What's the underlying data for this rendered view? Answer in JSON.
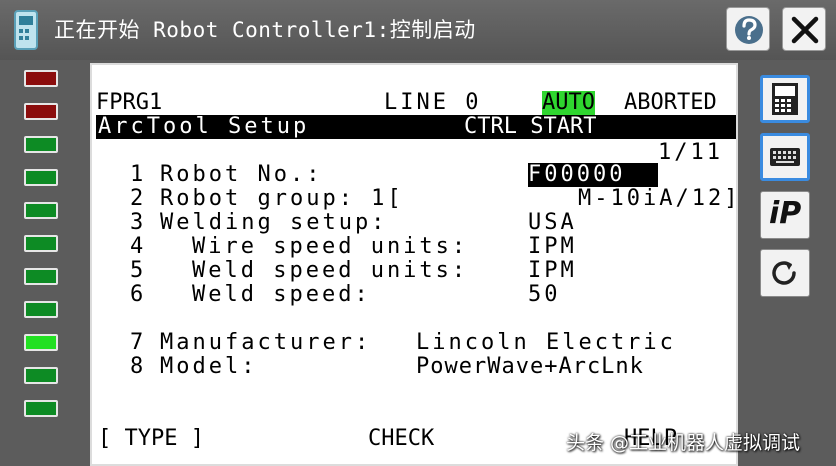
{
  "window": {
    "title": "正在开始 Robot Controller1:控制启动",
    "help_icon": "question-mark-icon",
    "close_icon": "close-x-icon"
  },
  "leds": [
    {
      "state": "red"
    },
    {
      "state": "red"
    },
    {
      "state": "green"
    },
    {
      "state": "green"
    },
    {
      "state": "green"
    },
    {
      "state": "green"
    },
    {
      "state": "green"
    },
    {
      "state": "green"
    },
    {
      "state": "green-lit"
    },
    {
      "state": "green"
    },
    {
      "state": "green"
    }
  ],
  "colors": {
    "led_red": "#8b0d0d",
    "led_green": "#0d8b24",
    "led_green_lit": "#22e022",
    "auto_highlight": "#2fd62f",
    "active_border": "#3a8be0"
  },
  "teach_pendant": {
    "program": "FPRG1",
    "line_label": "LINE 0",
    "mode": "AUTO",
    "status": "ABORTED",
    "screen_title": "ArcTool Setup",
    "screen_action": "CTRL START",
    "page": "1/11",
    "items": [
      {
        "num": "1",
        "label": "Robot No.:",
        "value": "F00000"
      },
      {
        "num": "2",
        "label": "Robot group: 1[",
        "value": "M-10iA/12]"
      },
      {
        "num": "3",
        "label": "Welding setup:",
        "value": "USA"
      },
      {
        "num": "4",
        "label": "Wire speed units:",
        "value": "IPM"
      },
      {
        "num": "5",
        "label": "Weld speed units:",
        "value": "IPM"
      },
      {
        "num": "6",
        "label": "Weld speed:",
        "value": "50"
      },
      {
        "num": "7",
        "label": "Manufacturer:",
        "value": "Lincoln Electric"
      },
      {
        "num": "8",
        "label": "Model:",
        "value": "PowerWave+ArcLnk"
      }
    ],
    "softkeys": {
      "f1": "[ TYPE ]",
      "f3": "CHECK",
      "f5": "HELP"
    }
  },
  "side_buttons": [
    {
      "icon": "teach-pendant-icon",
      "active": true
    },
    {
      "icon": "keyboard-icon",
      "active": true
    },
    {
      "icon": "ip-icon",
      "label": "iP",
      "active": false
    },
    {
      "icon": "refresh-icon",
      "active": false
    }
  ],
  "watermark": "头条 @工业机器人虚拟调试"
}
